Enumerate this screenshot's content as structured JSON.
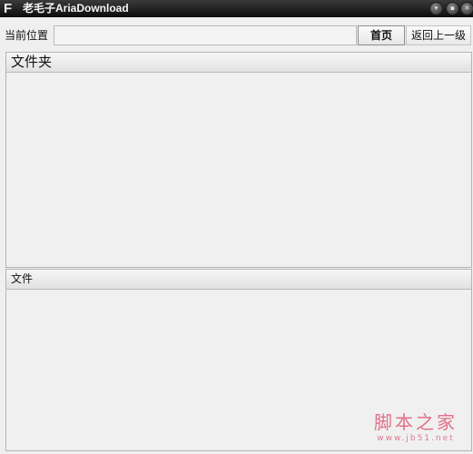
{
  "window": {
    "logo_letter": "F",
    "title": "老毛子AriaDownload",
    "controls": {
      "minimize": "▾",
      "maximize": "▪",
      "close": "✕"
    }
  },
  "path_bar": {
    "label": "当前位置",
    "value": "",
    "home_label": "首页",
    "back_label": "返回上一级"
  },
  "folders_panel": {
    "header": "文件夹",
    "items": []
  },
  "files_panel": {
    "header": "文件",
    "items": []
  },
  "watermark": {
    "main": "脚本之家",
    "url": "www.jb51.net"
  },
  "colors": {
    "titlebar": "#1a1a1a",
    "background": "#efefef",
    "watermark": "#e0708a"
  },
  "icons": [
    "app-logo-icon",
    "minimize-icon",
    "maximize-icon",
    "close-icon"
  ]
}
